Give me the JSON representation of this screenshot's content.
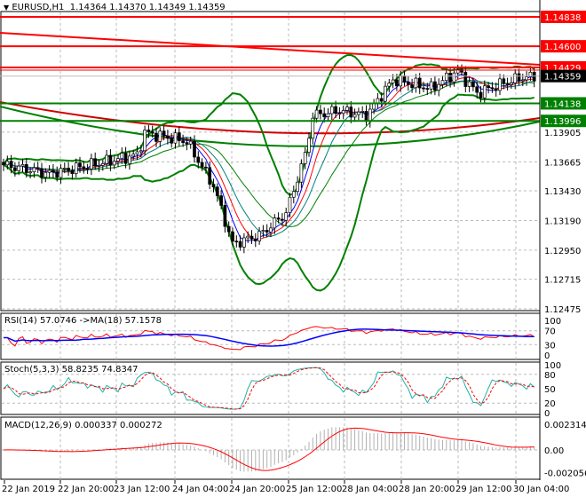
{
  "header": {
    "symbol": "EURUSD,H1",
    "ohlc": "1.14364 1.14370 1.14349 1.14359"
  },
  "price_axis": {
    "ticks": [
      "1.13905",
      "1.13665",
      "1.13430",
      "1.13190",
      "1.12950",
      "1.12715",
      "1.12475"
    ],
    "levels": [
      {
        "label": "1.14838",
        "color": "#ff0000"
      },
      {
        "label": "1.14600",
        "color": "#ff0000"
      },
      {
        "label": "1.14429",
        "color": "#ff0000"
      },
      {
        "label": "1.14138",
        "color": "#008000"
      },
      {
        "label": "1.13996",
        "color": "#008000"
      }
    ],
    "current": {
      "label": "1.14359",
      "color": "#000000"
    }
  },
  "rsi": {
    "title": "RSI(14) 57.0746  ->MA(18) 57.1578",
    "ticks": [
      "100",
      "70",
      "30",
      "0"
    ]
  },
  "stoch": {
    "title": "Stoch(5,3,3) 58.8235 74.8347",
    "ticks": [
      "100",
      "80",
      "50",
      "20",
      "0"
    ]
  },
  "macd": {
    "title": "MACD(12,26,9) 0.000337 0.000272",
    "ticks": [
      "0.002314",
      "0.00",
      "-0.002056"
    ]
  },
  "time_axis": [
    "22 Jan 2019",
    "22 Jan 20:00",
    "23 Jan 12:00",
    "24 Jan 04:00",
    "24 Jan 20:00",
    "25 Jan 12:00",
    "28 Jan 04:00",
    "28 Jan 20:00",
    "29 Jan 12:00",
    "30 Jan 04:00"
  ],
  "chart_data": {
    "type": "candlestick",
    "symbol": "EURUSD",
    "timeframe": "H1",
    "bars": 140,
    "ylim": [
      1.12475,
      1.14838
    ],
    "price_path_anchors": [
      [
        0,
        1.1364
      ],
      [
        12,
        1.1357
      ],
      [
        23,
        1.1364
      ],
      [
        35,
        1.1372
      ],
      [
        37,
        1.139
      ],
      [
        48,
        1.1383
      ],
      [
        55,
        1.1347
      ],
      [
        60,
        1.13
      ],
      [
        67,
        1.1307
      ],
      [
        74,
        1.1325
      ],
      [
        79,
        1.1372
      ],
      [
        81,
        1.1404
      ],
      [
        88,
        1.1408
      ],
      [
        95,
        1.1404
      ],
      [
        102,
        1.1433
      ],
      [
        112,
        1.1426
      ],
      [
        119,
        1.144
      ],
      [
        124,
        1.1422
      ],
      [
        130,
        1.1429
      ],
      [
        136,
        1.1435
      ]
    ],
    "horizontal_levels": [
      1.14838,
      1.146,
      1.14429,
      1.14138,
      1.13996
    ],
    "last_price": 1.14359
  }
}
